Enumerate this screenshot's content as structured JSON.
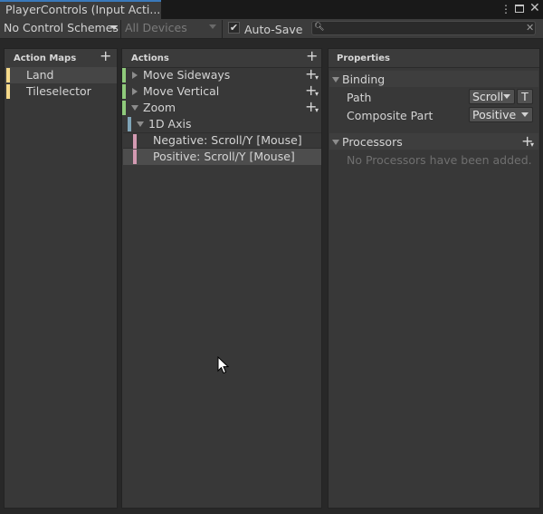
{
  "window": {
    "tab_title": "PlayerControls (Input Acti...",
    "menu_icon": "kebab-menu-icon",
    "maximize_icon": "maximize-icon",
    "close_icon": "close-icon"
  },
  "toolbar": {
    "control_scheme": "No Control Schemes",
    "devices": "All Devices",
    "autosave_label": "Auto-Save",
    "autosave_checked": true,
    "search_value": "",
    "search_icon": "search-icon",
    "clear_icon": "clear-icon"
  },
  "action_maps": {
    "title": "Action Maps",
    "items": [
      {
        "label": "Land",
        "color": "#f5d98a",
        "selected": true
      },
      {
        "label": "Tileselector",
        "color": "#f5d98a",
        "selected": false
      }
    ]
  },
  "actions": {
    "title": "Actions",
    "items": [
      {
        "label": "Move Sideways",
        "color": "#8fca7b",
        "expanded": false
      },
      {
        "label": "Move Vertical",
        "color": "#8fca7b",
        "expanded": false
      },
      {
        "label": "Zoom",
        "color": "#8fca7b",
        "expanded": true
      }
    ],
    "composite": {
      "label": "1D Axis",
      "color": "#7fa5b8"
    },
    "bindings": [
      {
        "label": "Negative: Scroll/Y [Mouse]",
        "color": "#d39ab2"
      },
      {
        "label": "Positive: Scroll/Y [Mouse]",
        "color": "#d39ab2",
        "selected": true
      }
    ]
  },
  "properties": {
    "title": "Properties",
    "binding_section": "Binding",
    "path_label": "Path",
    "path_value": "Scroll",
    "t_button": "T",
    "composite_label": "Composite Part",
    "composite_value": "Positive",
    "processors_section": "Processors",
    "processors_empty": "No Processors have been added."
  },
  "colors": {
    "accent": "#3a79bb",
    "panel": "#383838",
    "background": "#282828"
  }
}
